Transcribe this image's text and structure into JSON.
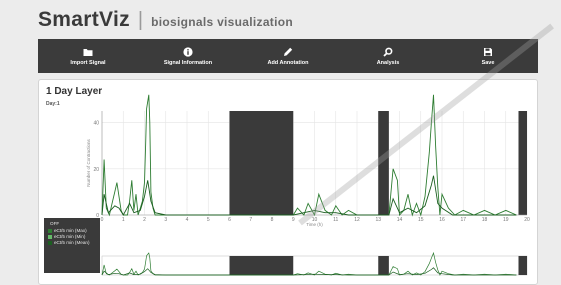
{
  "header": {
    "app_name": "SmartViz",
    "separator": "|",
    "tagline": "biosignals visualization"
  },
  "toolbar": {
    "items": [
      {
        "label": "Import Signal",
        "icon": "folder-icon"
      },
      {
        "label": "Signal Information",
        "icon": "info-icon"
      },
      {
        "label": "Add Annotation",
        "icon": "pencil-icon"
      },
      {
        "label": "Analysis",
        "icon": "search-icon"
      },
      {
        "label": "Save",
        "icon": "floppy-disk-icon"
      }
    ]
  },
  "panel": {
    "title": "1 Day Layer",
    "day_label": "Day:1"
  },
  "legend": {
    "header": "OFF",
    "items": [
      {
        "label": "eCt/5 min (Max)",
        "color": "#2e7d32"
      },
      {
        "label": "eCt/5 min (Min)",
        "color": "#66bb6a"
      },
      {
        "label": "eCt/5 min (Mean)",
        "color": "#1b5e20"
      }
    ]
  },
  "chart_data": {
    "type": "line",
    "xlabel": "Time (h)",
    "ylabel": "Number of Contractions",
    "xlim": [
      0,
      20
    ],
    "ylim": [
      0,
      45
    ],
    "xticks": [
      0,
      1,
      2,
      3,
      4,
      5,
      6,
      7,
      8,
      9,
      10,
      11,
      12,
      13,
      14,
      15,
      16,
      17,
      18,
      19,
      20
    ],
    "yticks": [
      0,
      20,
      40
    ],
    "off_periods": [
      [
        6,
        9
      ],
      [
        13,
        13.5
      ],
      [
        19.6,
        20
      ]
    ],
    "series": [
      {
        "name": "eCt/5 min (Max)",
        "color": "#2e7d32",
        "x": [
          0,
          0.1,
          0.2,
          0.35,
          0.5,
          0.6,
          0.7,
          0.8,
          0.9,
          1.0,
          1.2,
          1.3,
          1.4,
          1.5,
          1.6,
          1.7,
          1.8,
          1.9,
          2.0,
          2.05,
          2.1,
          2.2,
          2.25,
          2.3,
          2.4,
          2.5,
          2.6,
          2.7,
          2.8,
          2.9,
          3.0,
          5.9,
          9.0,
          9.2,
          9.5,
          9.7,
          10.0,
          10.2,
          10.5,
          10.8,
          11.0,
          11.3,
          11.6,
          12.0,
          12.5,
          12.9,
          13.5,
          13.7,
          13.9,
          14.0,
          14.2,
          14.4,
          14.6,
          14.8,
          15.0,
          15.2,
          15.4,
          15.5,
          15.6,
          15.7,
          15.8,
          15.9,
          16.0,
          16.3,
          16.6,
          17.0,
          17.5,
          18.0,
          18.5,
          19.0,
          19.5
        ],
        "y": [
          0,
          24,
          3,
          0,
          6,
          10,
          14,
          8,
          2,
          0,
          0,
          6,
          15,
          2,
          9,
          0,
          3,
          6,
          14,
          30,
          46,
          52,
          40,
          10,
          3,
          0,
          0,
          0,
          0,
          0,
          0,
          0,
          0,
          3,
          0,
          5,
          0,
          9,
          2,
          0,
          4,
          0,
          2,
          0,
          0,
          0,
          0,
          20,
          15,
          0,
          2,
          9,
          0,
          5,
          0,
          8,
          27,
          40,
          52,
          30,
          12,
          0,
          9,
          3,
          0,
          2,
          0,
          2,
          0,
          2,
          0
        ]
      },
      {
        "name": "eCt/5 min (Mean)",
        "color": "#1b5e20",
        "x": [
          0,
          0.1,
          0.3,
          0.6,
          0.8,
          1.0,
          1.3,
          1.5,
          1.8,
          2.0,
          2.15,
          2.3,
          2.5,
          3.0,
          5.9,
          9.0,
          9.5,
          10.0,
          10.5,
          11.0,
          11.6,
          12.0,
          13.5,
          13.7,
          14.0,
          14.4,
          14.8,
          15.2,
          15.5,
          15.6,
          15.8,
          16.0,
          16.5,
          17.0,
          18.0,
          19.5
        ],
        "y": [
          0,
          9,
          1,
          4,
          3,
          0,
          5,
          1,
          2,
          8,
          15,
          6,
          1,
          0,
          0,
          0,
          1,
          2,
          1,
          1,
          0,
          0,
          0,
          7,
          1,
          3,
          1,
          4,
          13,
          17,
          5,
          3,
          0,
          0,
          0,
          0
        ]
      }
    ]
  }
}
